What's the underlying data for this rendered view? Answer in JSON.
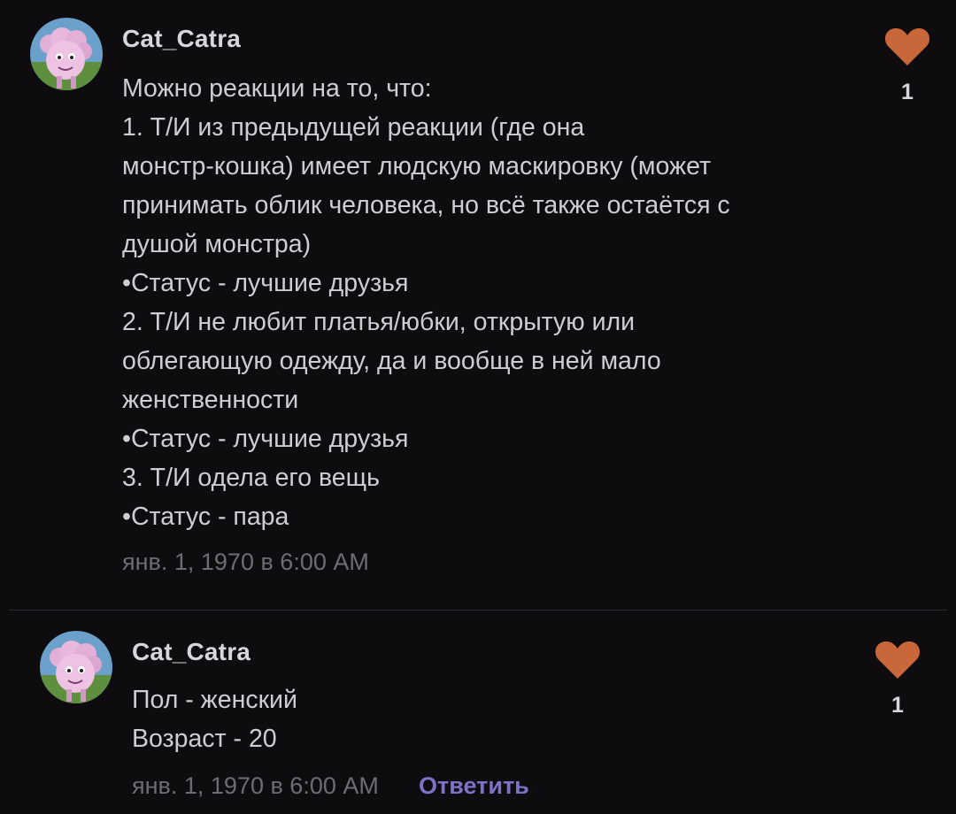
{
  "comments": [
    {
      "username": "Cat_Catra",
      "lines": [
        "Можно реакции на то, что:",
        "1. Т/И из предыдущей реакции (где она",
        "монстр-кошка) имеет людскую маскировку (может",
        "принимать облик человека, но всё также остаётся с",
        "душой монстра)",
        "•Статус - лучшие друзья",
        "2. Т/И не любит платья/юбки, открытую или",
        "облегающую одежду, да и вообще в ней мало",
        "женственности",
        "•Статус - лучшие друзья",
        "3. Т/И одела его вещь",
        "•Статус - пара"
      ],
      "timestamp": "янв. 1, 1970 в 6:00 AM",
      "likes": "1"
    },
    {
      "username": "Cat_Catra",
      "lines": [
        "Пол - женский",
        "Возраст - 20"
      ],
      "timestamp": "янв. 1, 1970 в 6:00 AM",
      "reply_label": "Ответить",
      "likes": "1"
    }
  ],
  "colors": {
    "background": "#0e0c0f",
    "heart": "#c8673a",
    "reply_link": "#7c73c9"
  },
  "icons": {
    "like": "heart-icon",
    "avatar": "pink-sheep-avatar"
  }
}
